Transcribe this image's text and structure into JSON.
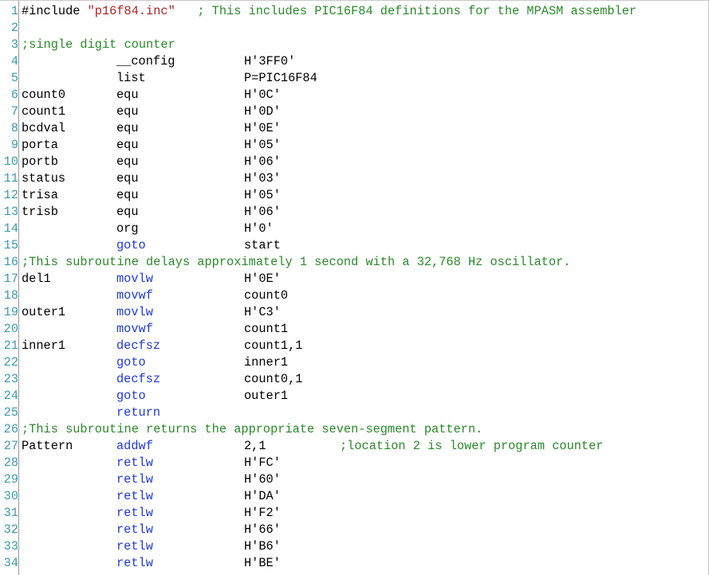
{
  "editor": {
    "lines": [
      {
        "n": "1",
        "parts": [
          {
            "t": "#include ",
            "c": "dir"
          },
          {
            "t": "\"p16f84.inc\"",
            "c": "str"
          },
          {
            "t": "   ; This includes PIC16F84 definitions for the MPASM assembler",
            "c": "cmt"
          }
        ]
      },
      {
        "n": "2"
      },
      {
        "n": "3",
        "comment": ";single digit counter"
      },
      {
        "n": "4",
        "op": "__config",
        "opc": "dir",
        "arg": "H'3FF0'"
      },
      {
        "n": "5",
        "op": "list",
        "opc": "dir",
        "arg": "P=PIC16F84"
      },
      {
        "n": "6",
        "label": "count0",
        "op": "equ",
        "opc": "dir",
        "arg": "H'0C'"
      },
      {
        "n": "7",
        "label": "count1",
        "op": "equ",
        "opc": "dir",
        "arg": "H'0D'"
      },
      {
        "n": "8",
        "label": "bcdval",
        "op": "equ",
        "opc": "dir",
        "arg": "H'0E'"
      },
      {
        "n": "9",
        "label": "porta",
        "op": "equ",
        "opc": "dir",
        "arg": "H'05'"
      },
      {
        "n": "10",
        "label": "portb",
        "op": "equ",
        "opc": "dir",
        "arg": "H'06'"
      },
      {
        "n": "11",
        "label": "status",
        "op": "equ",
        "opc": "dir",
        "arg": "H'03'"
      },
      {
        "n": "12",
        "label": "trisa",
        "op": "equ",
        "opc": "dir",
        "arg": "H'05'"
      },
      {
        "n": "13",
        "label": "trisb",
        "op": "equ",
        "opc": "dir",
        "arg": "H'06'"
      },
      {
        "n": "14",
        "op": "org",
        "opc": "dir",
        "arg": "H'0'"
      },
      {
        "n": "15",
        "op": "goto",
        "opc": "ins",
        "arg": "start"
      },
      {
        "n": "16",
        "comment": ";This subroutine delays approximately 1 second with a 32,768 Hz oscillator."
      },
      {
        "n": "17",
        "label": "del1",
        "op": "movlw",
        "opc": "ins",
        "arg": "H'0E'"
      },
      {
        "n": "18",
        "op": "movwf",
        "opc": "ins",
        "arg": "count0"
      },
      {
        "n": "19",
        "label": "outer1",
        "op": "movlw",
        "opc": "ins",
        "arg": "H'C3'"
      },
      {
        "n": "20",
        "op": "movwf",
        "opc": "ins",
        "arg": "count1"
      },
      {
        "n": "21",
        "label": "inner1",
        "op": "decfsz",
        "opc": "ins",
        "arg": "count1,1"
      },
      {
        "n": "22",
        "op": "goto",
        "opc": "ins",
        "arg": "inner1"
      },
      {
        "n": "23",
        "op": "decfsz",
        "opc": "ins",
        "arg": "count0,1"
      },
      {
        "n": "24",
        "op": "goto",
        "opc": "ins",
        "arg": "outer1"
      },
      {
        "n": "25",
        "op": "return",
        "opc": "ins"
      },
      {
        "n": "26",
        "comment": ";This subroutine returns the appropriate seven-segment pattern."
      },
      {
        "n": "27",
        "label": "Pattern",
        "op": "addwf",
        "opc": "ins",
        "arg": "2,1",
        "tail": ";location 2 is lower program counter"
      },
      {
        "n": "28",
        "op": "retlw",
        "opc": "ins",
        "arg": "H'FC'"
      },
      {
        "n": "29",
        "op": "retlw",
        "opc": "ins",
        "arg": "H'60'"
      },
      {
        "n": "30",
        "op": "retlw",
        "opc": "ins",
        "arg": "H'DA'"
      },
      {
        "n": "31",
        "op": "retlw",
        "opc": "ins",
        "arg": "H'F2'"
      },
      {
        "n": "32",
        "op": "retlw",
        "opc": "ins",
        "arg": "H'66'"
      },
      {
        "n": "33",
        "op": "retlw",
        "opc": "ins",
        "arg": "H'B6'"
      },
      {
        "n": "34",
        "op": "retlw",
        "opc": "ins",
        "arg": "H'BE'"
      }
    ]
  },
  "colors": {
    "line_number": "#3e9ab0",
    "instruction": "#1f39d8",
    "string": "#b22222",
    "comment": "#2a8a2a",
    "text": "#000000"
  }
}
